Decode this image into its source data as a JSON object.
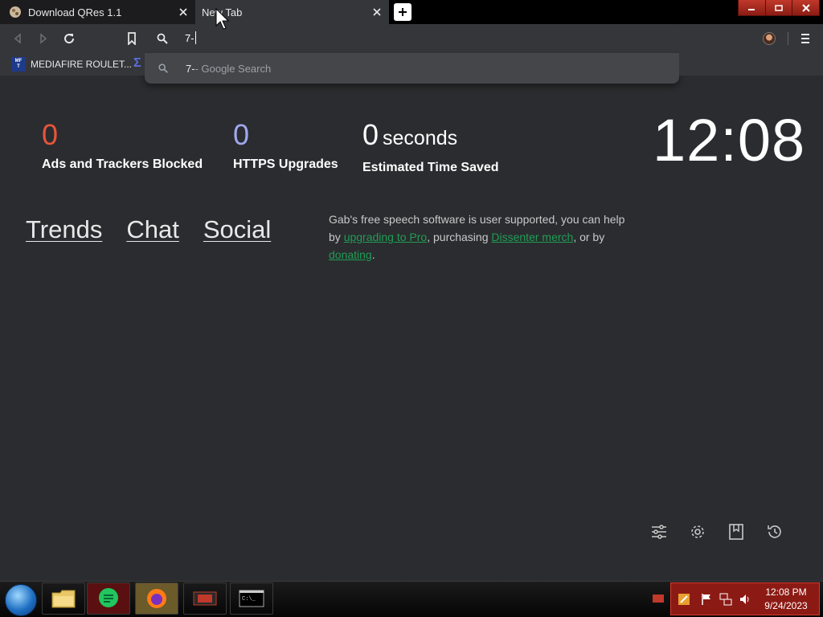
{
  "tabs": [
    {
      "title": "Download QRes 1.1",
      "active": false
    },
    {
      "title": "New Tab",
      "active": true
    }
  ],
  "omnibox": {
    "input_value": "7-",
    "suggestion": {
      "query": "7-",
      "suffix": " - Google Search"
    }
  },
  "bookmarks": {
    "items": [
      {
        "label": "MEDIAFIRE ROULET..."
      }
    ]
  },
  "stats": {
    "ads_count": "0",
    "ads_label": "Ads and Trackers Blocked",
    "https_count": "0",
    "https_label": "HTTPS Upgrades",
    "time_count": "0",
    "time_unit": "seconds",
    "time_label": "Estimated Time Saved"
  },
  "clock": "12:08",
  "links": [
    "Trends",
    "Chat",
    "Social"
  ],
  "gab_text": {
    "part1": "Gab's free speech software is user supported, you can help by ",
    "link1": "upgrading to Pro",
    "part2": ", purchasing ",
    "link2": "Dissenter merch",
    "part3": ", or by ",
    "link3": "donating",
    "part4": "."
  },
  "taskbar": {
    "time": "12:08 PM",
    "date": "9/24/2023"
  },
  "colors": {
    "ads_count": "#e8553a",
    "https_count": "#a0a8f0",
    "link_green": "#1f9d55",
    "page_bg": "#2b2c2f"
  }
}
